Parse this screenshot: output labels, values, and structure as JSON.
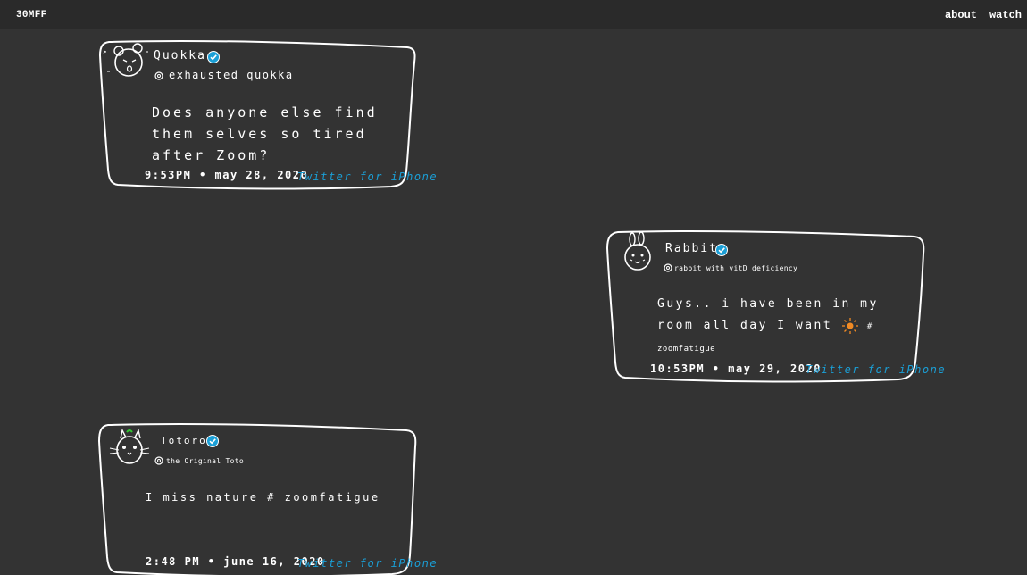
{
  "header": {
    "brand": "30MFF",
    "nav": [
      {
        "label": "about"
      },
      {
        "label": "watch"
      }
    ]
  },
  "colors": {
    "background": "#333333",
    "topbar": "#2a2a2a",
    "accent_blue": "#1b9fd6",
    "sun_orange": "#f08a24",
    "tuft_green": "#32c832"
  },
  "tweets": [
    {
      "avatar_icon": "quokka-avatar-icon",
      "name": "Quokka",
      "handle": "exhausted quokka",
      "body": "Does anyone else find them selves so tired after Zoom?",
      "timestamp": "9:53PM • may 28, 2020",
      "client": "Twitter for iPhone"
    },
    {
      "avatar_icon": "rabbit-avatar-icon",
      "name": "Rabbit",
      "handle": "rabbit with vitD deficiency",
      "body_before": "Guys.. i have been in my room all day I want",
      "body_icon": "sun-icon",
      "body_after": "# zoomfatigue",
      "timestamp": "10:53PM • may 29, 2020",
      "client": "Twitter for iPhone"
    },
    {
      "avatar_icon": "totoro-avatar-icon",
      "name": "Totoro",
      "handle": "the Original Toto",
      "body": "I miss nature # zoomfatigue",
      "timestamp": "2:48 PM • june 16, 2020",
      "client": "Twitter for iPhone"
    }
  ]
}
